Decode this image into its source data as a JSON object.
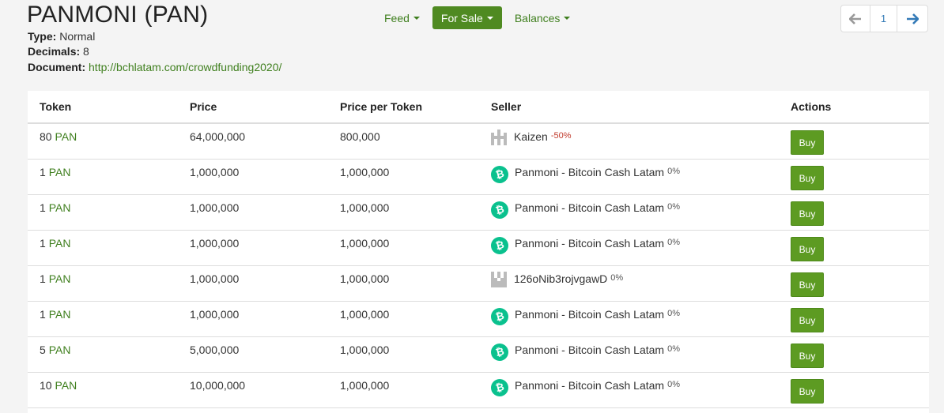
{
  "token": {
    "title": "PANMONI (PAN)",
    "type_label": "Type:",
    "type_value": "Normal",
    "decimals_label": "Decimals:",
    "decimals_value": "8",
    "document_label": "Document:",
    "document_value": "http://bchlatam.com/crowdfunding2020/"
  },
  "nav": {
    "feed": "Feed",
    "for_sale": "For Sale",
    "balances": "Balances"
  },
  "pager": {
    "prev_icon": "arrow-left-icon",
    "page": "1",
    "next_icon": "arrow-right-icon"
  },
  "table": {
    "headers": [
      "Token",
      "Price",
      "Price per Token",
      "Seller",
      "Actions"
    ],
    "buy_label": "Buy",
    "rows": [
      {
        "amount": "80",
        "unit": "PAN",
        "price": "64,000,000",
        "price_per_token": "800,000",
        "seller": "Kaizen",
        "discount": "-50%",
        "icon": "identicon"
      },
      {
        "amount": "1",
        "unit": "PAN",
        "price": "1,000,000",
        "price_per_token": "1,000,000",
        "seller": "Panmoni - Bitcoin Cash Latam",
        "discount": "0%",
        "icon": "bch"
      },
      {
        "amount": "1",
        "unit": "PAN",
        "price": "1,000,000",
        "price_per_token": "1,000,000",
        "seller": "Panmoni - Bitcoin Cash Latam",
        "discount": "0%",
        "icon": "bch"
      },
      {
        "amount": "1",
        "unit": "PAN",
        "price": "1,000,000",
        "price_per_token": "1,000,000",
        "seller": "Panmoni - Bitcoin Cash Latam",
        "discount": "0%",
        "icon": "bch"
      },
      {
        "amount": "1",
        "unit": "PAN",
        "price": "1,000,000",
        "price_per_token": "1,000,000",
        "seller": "126oNib3rojvgawD",
        "discount": "0%",
        "icon": "identicon2"
      },
      {
        "amount": "1",
        "unit": "PAN",
        "price": "1,000,000",
        "price_per_token": "1,000,000",
        "seller": "Panmoni - Bitcoin Cash Latam",
        "discount": "0%",
        "icon": "bch"
      },
      {
        "amount": "5",
        "unit": "PAN",
        "price": "5,000,000",
        "price_per_token": "1,000,000",
        "seller": "Panmoni - Bitcoin Cash Latam",
        "discount": "0%",
        "icon": "bch"
      },
      {
        "amount": "10",
        "unit": "PAN",
        "price": "10,000,000",
        "price_per_token": "1,000,000",
        "seller": "Panmoni - Bitcoin Cash Latam",
        "discount": "0%",
        "icon": "bch"
      }
    ]
  },
  "colors": {
    "accent": "#4f8a21",
    "link": "#3f7f1e",
    "bch": "#0ac18e",
    "negative": "#c0392b"
  }
}
